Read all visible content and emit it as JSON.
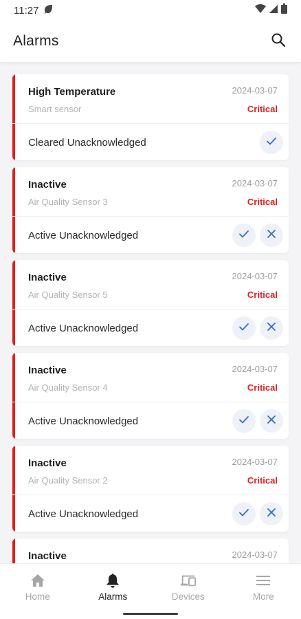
{
  "status_bar": {
    "time": "11:27"
  },
  "app_bar": {
    "title": "Alarms"
  },
  "alarms": [
    {
      "title": "High Temperature",
      "date": "2024-03-07",
      "originator": "Smart sensor",
      "severity": "Critical",
      "status": "Cleared Unacknowledged",
      "actions": [
        "acknowledge"
      ]
    },
    {
      "title": "Inactive",
      "date": "2024-03-07",
      "originator": "Air Quality Sensor 3",
      "severity": "Critical",
      "status": "Active Unacknowledged",
      "actions": [
        "acknowledge",
        "clear"
      ]
    },
    {
      "title": "Inactive",
      "date": "2024-03-07",
      "originator": "Air Quality Sensor 5",
      "severity": "Critical",
      "status": "Active Unacknowledged",
      "actions": [
        "acknowledge",
        "clear"
      ]
    },
    {
      "title": "Inactive",
      "date": "2024-03-07",
      "originator": "Air Quality Sensor 4",
      "severity": "Critical",
      "status": "Active Unacknowledged",
      "actions": [
        "acknowledge",
        "clear"
      ]
    },
    {
      "title": "Inactive",
      "date": "2024-03-07",
      "originator": "Air Quality Sensor 2",
      "severity": "Critical",
      "status": "Active Unacknowledged",
      "actions": [
        "acknowledge",
        "clear"
      ]
    },
    {
      "title": "Inactive",
      "date": "2024-03-07",
      "originator": "",
      "severity": "",
      "status": "",
      "actions": []
    }
  ],
  "bottom_nav": {
    "items": [
      {
        "label": "Home",
        "icon": "home-icon",
        "active": false
      },
      {
        "label": "Alarms",
        "icon": "bell-icon",
        "active": true
      },
      {
        "label": "Devices",
        "icon": "devices-icon",
        "active": false
      },
      {
        "label": "More",
        "icon": "menu-icon",
        "active": false
      }
    ]
  },
  "colors": {
    "severity_critical": "#e0201d",
    "action_icon": "#2f6fc9",
    "action_bg": "#eef1f7",
    "nav_inactive": "#a7a7a7",
    "nav_active": "#222222"
  }
}
